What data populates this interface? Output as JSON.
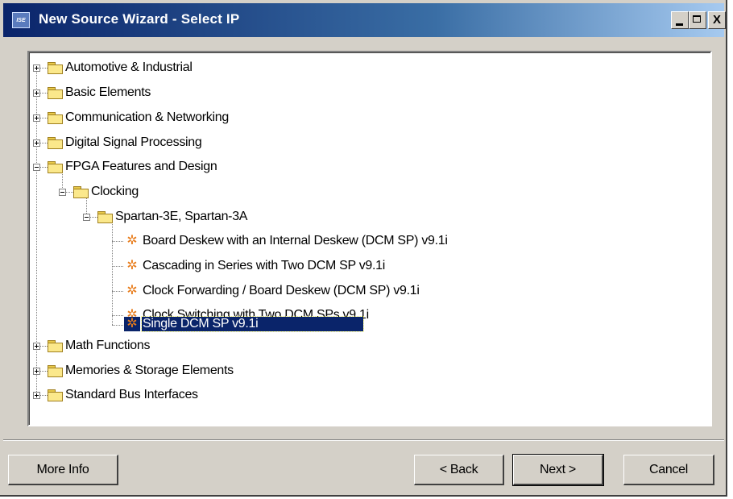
{
  "window": {
    "title": "New Source Wizard - Select IP",
    "app_icon_text": "ISE",
    "close_glyph": "X"
  },
  "tree": {
    "categories": [
      {
        "label": "Automotive & Industrial",
        "expanded": false
      },
      {
        "label": "Basic Elements",
        "expanded": false
      },
      {
        "label": "Communication & Networking",
        "expanded": false
      },
      {
        "label": "Digital Signal Processing",
        "expanded": false
      },
      {
        "label": "FPGA Features and Design",
        "expanded": true
      },
      {
        "label": "Clocking",
        "expanded": true
      },
      {
        "label": "Spartan-3E, Spartan-3A",
        "expanded": true
      },
      {
        "label": "Math Functions",
        "expanded": false
      },
      {
        "label": "Memories & Storage Elements",
        "expanded": false
      },
      {
        "label": "Standard Bus Interfaces",
        "expanded": false
      }
    ],
    "ip_cores": [
      {
        "label": "Board Deskew with an Internal Deskew (DCM SP) v9.1i",
        "selected": false
      },
      {
        "label": "Cascading in Series with Two DCM SP v9.1i",
        "selected": false
      },
      {
        "label": "Clock Forwarding / Board Deskew (DCM SP) v9.1i",
        "selected": false
      },
      {
        "label": "Clock Switching with Two DCM SPs v9.1i",
        "selected": false
      },
      {
        "label": "Single DCM SP v9.1i",
        "selected": true
      }
    ]
  },
  "buttons": {
    "more_info": "More Info",
    "back": "< Back",
    "next": "Next >",
    "cancel": "Cancel"
  },
  "colors": {
    "title_start": "#0a246a",
    "title_end": "#a6caf0",
    "selection": "#0a246a",
    "dialog_face": "#d4d0c8",
    "ip_icon": "#e87d1d"
  },
  "icons": {
    "category": "folder-icon",
    "ip_core": "ip-core-icon",
    "collapsed": "plus-expander-icon",
    "expanded": "minus-expander-icon"
  }
}
